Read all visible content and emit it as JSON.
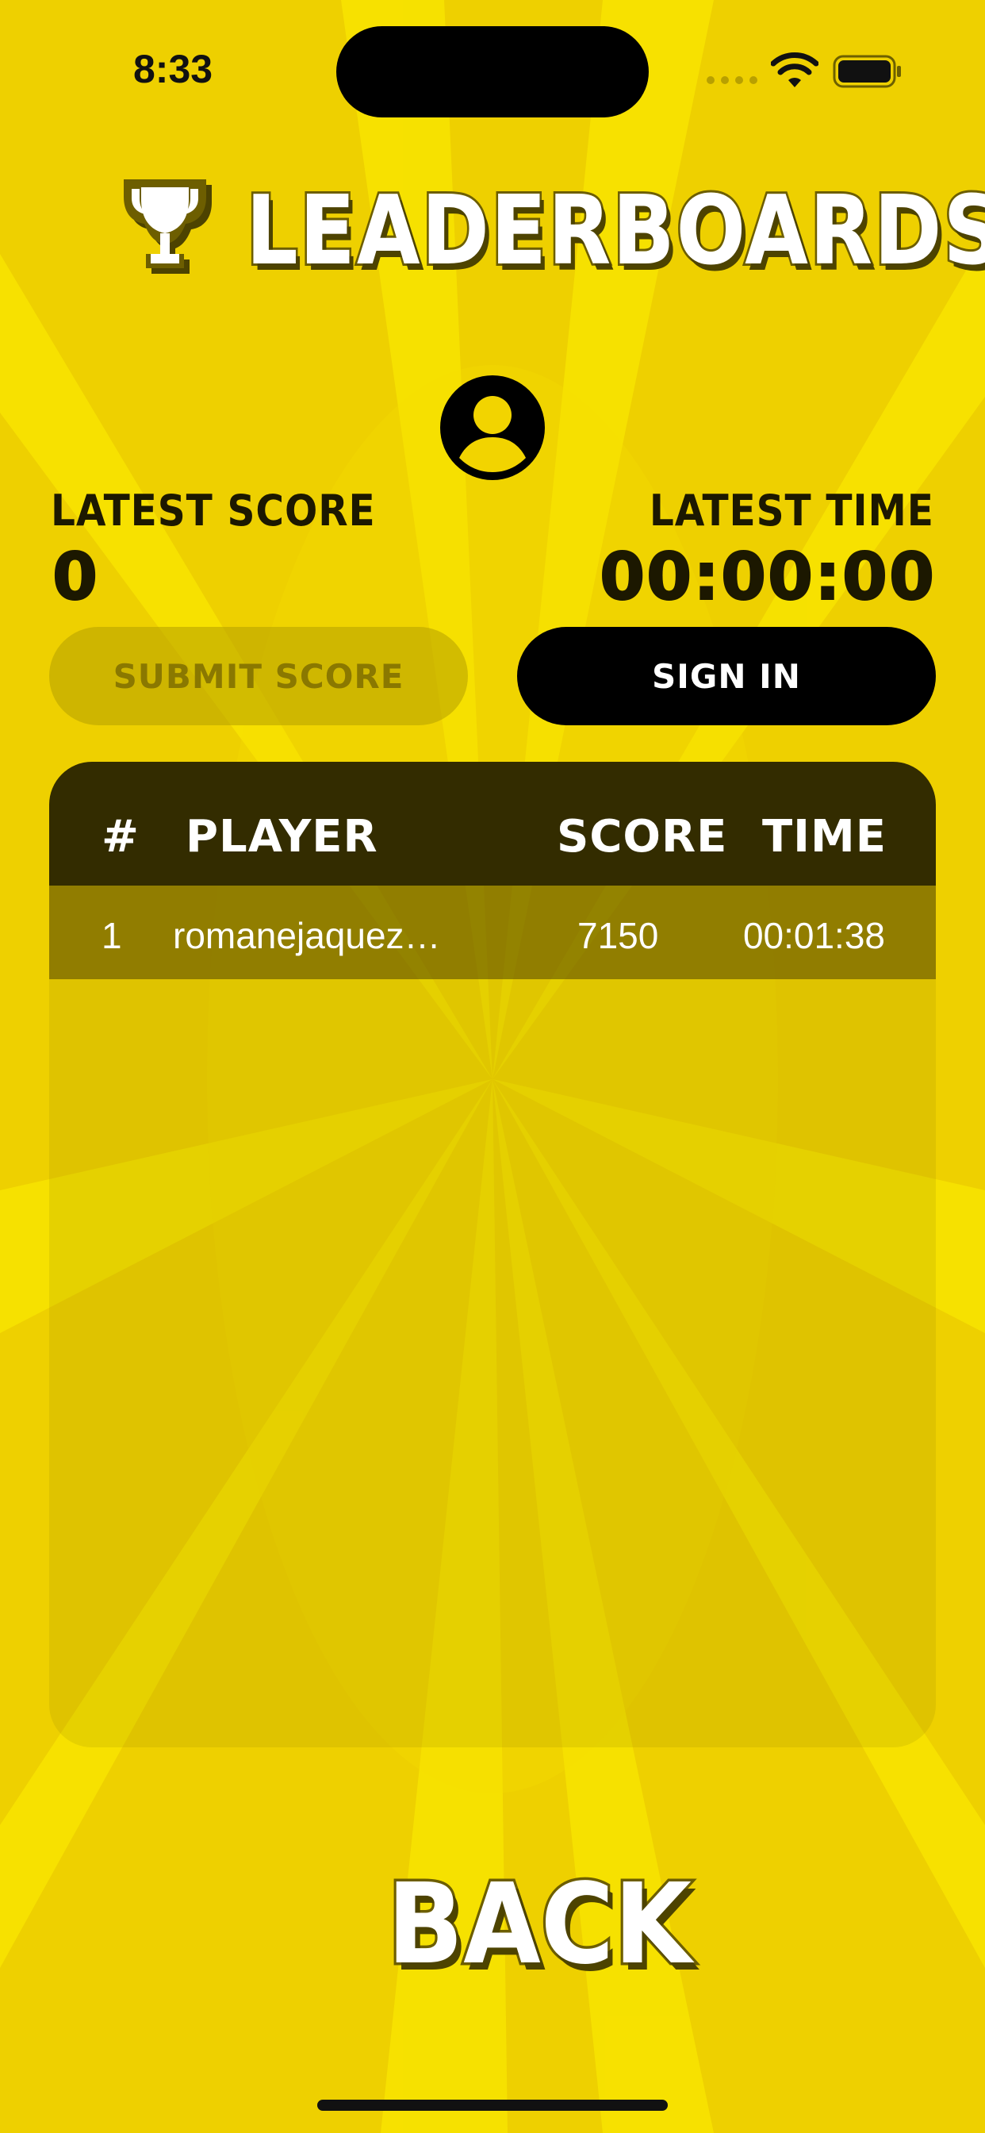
{
  "status_bar": {
    "time": "8:33"
  },
  "header": {
    "title": "LEADERBOARDS"
  },
  "stats": {
    "latest_score_label": "LATEST SCORE",
    "latest_score_value": "0",
    "latest_time_label": "LATEST TIME",
    "latest_time_value": "00:00:00"
  },
  "buttons": {
    "submit_label": "SUBMIT SCORE",
    "signin_label": "SIGN IN",
    "back_label": "BACK"
  },
  "table": {
    "headers": {
      "rank": "#",
      "player": "PLAYER",
      "score": "SCORE",
      "time": "TIME"
    },
    "rows": [
      {
        "rank": "1",
        "player": "romanejaquez…",
        "score": "7150",
        "time": "00:01:38"
      }
    ]
  },
  "colors": {
    "background": "#f2d400",
    "table_header": "#332c00",
    "accent_dark": "#000000"
  },
  "icons": [
    "trophy-icon",
    "person-icon",
    "wifi-icon",
    "battery-icon"
  ]
}
